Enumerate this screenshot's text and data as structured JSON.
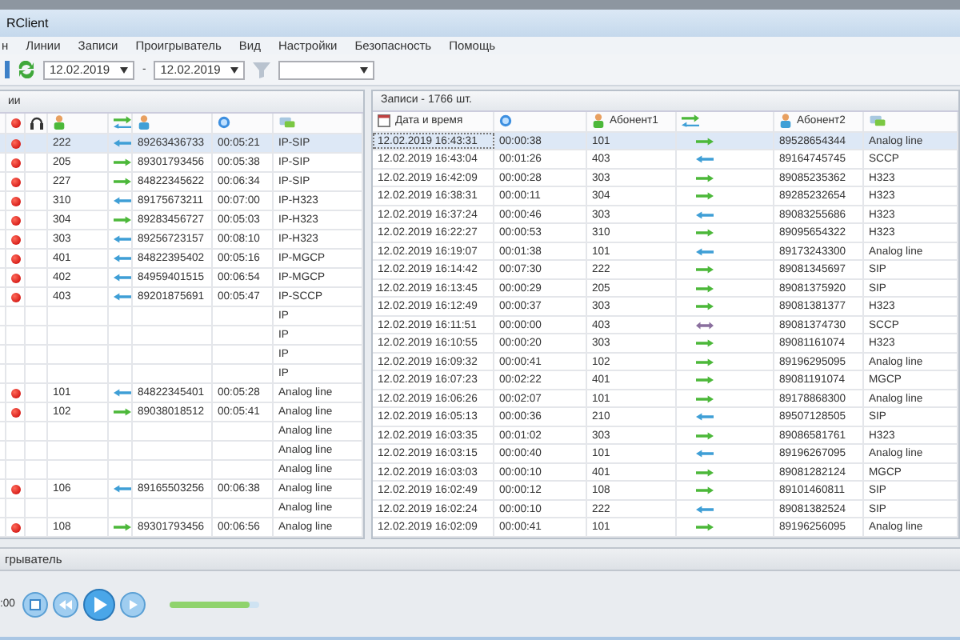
{
  "window": {
    "title": "RClient"
  },
  "menu": [
    {
      "label": "н"
    },
    {
      "label": "Линии"
    },
    {
      "label": "Записи"
    },
    {
      "label": "Проигрыватель"
    },
    {
      "label": "Вид"
    },
    {
      "label": "Настройки"
    },
    {
      "label": "Безопасность"
    },
    {
      "label": "Помощь"
    }
  ],
  "toolbar": {
    "date_from": "12.02.2019",
    "separator": "-",
    "date_to": "12.02.2019"
  },
  "lines_panel": {
    "title": "ии",
    "rows": [
      {
        "recording": true,
        "selected": true,
        "abonent1": "222",
        "kind": "in",
        "abonent2": "89263436733",
        "duration": "00:05:21",
        "line": "IP-SIP"
      },
      {
        "recording": true,
        "selected": false,
        "abonent1": "205",
        "kind": "out",
        "abonent2": "89301793456",
        "duration": "00:05:38",
        "line": "IP-SIP"
      },
      {
        "recording": true,
        "selected": false,
        "abonent1": "227",
        "kind": "out",
        "abonent2": "84822345622",
        "duration": "00:06:34",
        "line": "IP-SIP"
      },
      {
        "recording": true,
        "selected": false,
        "abonent1": "310",
        "kind": "in",
        "abonent2": "89175673211",
        "duration": "00:07:00",
        "line": "IP-H323"
      },
      {
        "recording": true,
        "selected": false,
        "abonent1": "304",
        "kind": "out",
        "abonent2": "89283456727",
        "duration": "00:05:03",
        "line": "IP-H323"
      },
      {
        "recording": true,
        "selected": false,
        "abonent1": "303",
        "kind": "in",
        "abonent2": "89256723157",
        "duration": "00:08:10",
        "line": "IP-H323"
      },
      {
        "recording": true,
        "selected": false,
        "abonent1": "401",
        "kind": "in",
        "abonent2": "84822395402",
        "duration": "00:05:16",
        "line": "IP-MGCP"
      },
      {
        "recording": true,
        "selected": false,
        "abonent1": "402",
        "kind": "in",
        "abonent2": "84959401515",
        "duration": "00:06:54",
        "line": "IP-MGCP"
      },
      {
        "recording": true,
        "selected": false,
        "abonent1": "403",
        "kind": "in",
        "abonent2": "89201875691",
        "duration": "00:05:47",
        "line": "IP-SCCP"
      },
      {
        "recording": false,
        "selected": false,
        "line": "IP"
      },
      {
        "recording": false,
        "selected": false,
        "line": "IP"
      },
      {
        "recording": false,
        "selected": false,
        "line": "IP"
      },
      {
        "recording": false,
        "selected": false,
        "line": "IP"
      },
      {
        "recording": true,
        "selected": false,
        "abonent1": "101",
        "kind": "in",
        "abonent2": "84822345401",
        "duration": "00:05:28",
        "line": "Analog line"
      },
      {
        "recording": true,
        "selected": false,
        "abonent1": "102",
        "kind": "out",
        "abonent2": "89038018512",
        "duration": "00:05:41",
        "line": "Analog line"
      },
      {
        "recording": false,
        "selected": false,
        "line": "Analog line"
      },
      {
        "recording": false,
        "selected": false,
        "line": "Analog line"
      },
      {
        "recording": false,
        "selected": false,
        "line": "Analog line"
      },
      {
        "recording": true,
        "selected": false,
        "abonent1": "106",
        "kind": "in",
        "abonent2": "89165503256",
        "duration": "00:06:38",
        "line": "Analog line"
      },
      {
        "recording": false,
        "selected": false,
        "line": "Analog line"
      },
      {
        "recording": true,
        "selected": false,
        "abonent1": "108",
        "kind": "out",
        "abonent2": "89301793456",
        "duration": "00:06:56",
        "line": "Analog line"
      }
    ]
  },
  "records_panel": {
    "title": "Записи - 1766 шт.",
    "columns": {
      "datetime": "Дата и время",
      "abonent1": "Абонент1",
      "abonent2": "Абонент2"
    },
    "rows": [
      {
        "selected": true,
        "datetime": "12.02.2019 16:43:31",
        "duration": "00:00:38",
        "abonent1": "101",
        "kind": "out",
        "abonent2": "89528654344",
        "line": "Analog line"
      },
      {
        "selected": false,
        "datetime": "12.02.2019 16:43:04",
        "duration": "00:01:26",
        "abonent1": "403",
        "kind": "in",
        "abonent2": "89164745745",
        "line": "SCCP"
      },
      {
        "selected": false,
        "datetime": "12.02.2019 16:42:09",
        "duration": "00:00:28",
        "abonent1": "303",
        "kind": "out",
        "abonent2": "89085235362",
        "line": "H323"
      },
      {
        "selected": false,
        "datetime": "12.02.2019 16:38:31",
        "duration": "00:00:11",
        "abonent1": "304",
        "kind": "out",
        "abonent2": "89285232654",
        "line": "H323"
      },
      {
        "selected": false,
        "datetime": "12.02.2019 16:37:24",
        "duration": "00:00:46",
        "abonent1": "303",
        "kind": "in",
        "abonent2": "89083255686",
        "line": "H323"
      },
      {
        "selected": false,
        "datetime": "12.02.2019 16:22:27",
        "duration": "00:00:53",
        "abonent1": "310",
        "kind": "out",
        "abonent2": "89095654322",
        "line": "H323"
      },
      {
        "selected": false,
        "datetime": "12.02.2019 16:19:07",
        "duration": "00:01:38",
        "abonent1": "101",
        "kind": "in",
        "abonent2": "89173243300",
        "line": "Analog line"
      },
      {
        "selected": false,
        "datetime": "12.02.2019 16:14:42",
        "duration": "00:07:30",
        "abonent1": "222",
        "kind": "out",
        "abonent2": "89081345697",
        "line": "SIP"
      },
      {
        "selected": false,
        "datetime": "12.02.2019 16:13:45",
        "duration": "00:00:29",
        "abonent1": "205",
        "kind": "out",
        "abonent2": "89081375920",
        "line": "SIP"
      },
      {
        "selected": false,
        "datetime": "12.02.2019 16:12:49",
        "duration": "00:00:37",
        "abonent1": "303",
        "kind": "out",
        "abonent2": "89081381377",
        "line": "H323"
      },
      {
        "selected": false,
        "datetime": "12.02.2019 16:11:51",
        "duration": "00:00:00",
        "abonent1": "403",
        "kind": "both",
        "abonent2": "89081374730",
        "line": "SCCP"
      },
      {
        "selected": false,
        "datetime": "12.02.2019 16:10:55",
        "duration": "00:00:20",
        "abonent1": "303",
        "kind": "out",
        "abonent2": "89081161074",
        "line": "H323"
      },
      {
        "selected": false,
        "datetime": "12.02.2019 16:09:32",
        "duration": "00:00:41",
        "abonent1": "102",
        "kind": "out",
        "abonent2": "89196295095",
        "line": "Analog line"
      },
      {
        "selected": false,
        "datetime": "12.02.2019 16:07:23",
        "duration": "00:02:22",
        "abonent1": "401",
        "kind": "out",
        "abonent2": "89081191074",
        "line": "MGCP"
      },
      {
        "selected": false,
        "datetime": "12.02.2019 16:06:26",
        "duration": "00:02:07",
        "abonent1": "101",
        "kind": "out",
        "abonent2": "89178868300",
        "line": "Analog line"
      },
      {
        "selected": false,
        "datetime": "12.02.2019 16:05:13",
        "duration": "00:00:36",
        "abonent1": "210",
        "kind": "in",
        "abonent2": "89507128505",
        "line": "SIP"
      },
      {
        "selected": false,
        "datetime": "12.02.2019 16:03:35",
        "duration": "00:01:02",
        "abonent1": "303",
        "kind": "out",
        "abonent2": "89086581761",
        "line": "H323"
      },
      {
        "selected": false,
        "datetime": "12.02.2019 16:03:15",
        "duration": "00:00:40",
        "abonent1": "101",
        "kind": "in",
        "abonent2": "89196267095",
        "line": "Analog line"
      },
      {
        "selected": false,
        "datetime": "12.02.2019 16:03:03",
        "duration": "00:00:10",
        "abonent1": "401",
        "kind": "out",
        "abonent2": "89081282124",
        "line": "MGCP"
      },
      {
        "selected": false,
        "datetime": "12.02.2019 16:02:49",
        "duration": "00:00:12",
        "abonent1": "108",
        "kind": "out",
        "abonent2": "89101460811",
        "line": "SIP"
      },
      {
        "selected": false,
        "datetime": "12.02.2019 16:02:24",
        "duration": "00:00:10",
        "abonent1": "222",
        "kind": "in",
        "abonent2": "89081382524",
        "line": "SIP"
      },
      {
        "selected": false,
        "datetime": "12.02.2019 16:02:09",
        "duration": "00:00:41",
        "abonent1": "101",
        "kind": "out",
        "abonent2": "89196256095",
        "line": "Analog line"
      }
    ]
  },
  "player": {
    "title": "грыватель",
    "time": ":00",
    "level": 0.88
  }
}
